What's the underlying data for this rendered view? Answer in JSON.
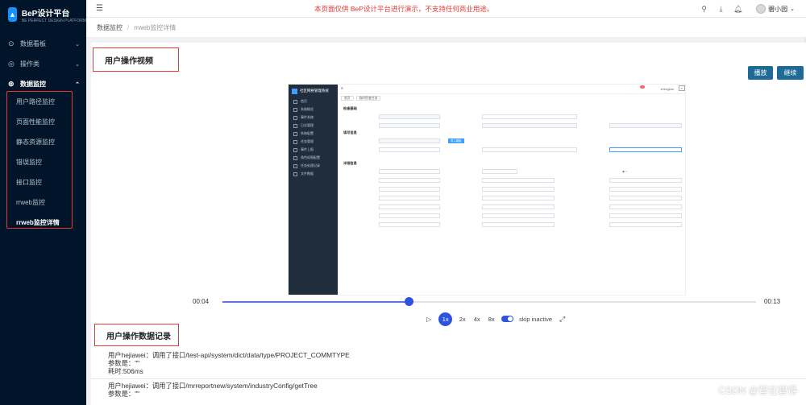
{
  "app": {
    "title": "BeP设计平台",
    "subtitle": "BE PERFECT DESIGN PLATFORM",
    "notice": "本页面仅供 BeP设计平台进行演示，不支持任何商业用途。",
    "user_name": "碧小园"
  },
  "sidebar": {
    "groups": [
      {
        "label": "数据看板",
        "icon": "dashboard-icon",
        "expanded": false
      },
      {
        "label": "操作类",
        "icon": "operation-icon",
        "expanded": false
      },
      {
        "label": "数据监控",
        "icon": "monitor-icon",
        "expanded": true
      }
    ],
    "items": [
      {
        "label": "用户路径监控"
      },
      {
        "label": "页面性能监控"
      },
      {
        "label": "静态资源监控"
      },
      {
        "label": "错误监控"
      },
      {
        "label": "接口监控"
      },
      {
        "label": "rrweb监控"
      },
      {
        "label": "rrweb监控详情",
        "active": true
      }
    ]
  },
  "breadcrumb": {
    "parent": "数据监控",
    "current": "rrweb监控详情"
  },
  "main": {
    "video_title": "用户操作视频",
    "play_label": "播放",
    "resume_label": "继续",
    "record_title": "用户操作数据记录"
  },
  "player": {
    "current_time": "00:04",
    "total_time": "00:13",
    "progress": 0.35,
    "speeds": [
      "1x",
      "2x",
      "4x",
      "8x"
    ],
    "active_speed": "1x",
    "skip_label": "skip inactive",
    "skip_enabled": true
  },
  "video_frame": {
    "app_name": "社区网格管理系统",
    "tabs": [
      "首页",
      "临时检查任务"
    ],
    "user": "zhengtao",
    "menu": [
      "首页",
      "系统概览",
      "事件系统",
      "日志管理",
      "系统配置",
      "任务管理",
      "事件上报",
      "角色权限配置",
      "任务处理记录",
      "文件数据"
    ],
    "sections": [
      "检查基础",
      "填写信息",
      "详细信息"
    ],
    "field_button": "导入模板"
  },
  "records": [
    {
      "action": "用户hejiawei：调用了接口/test-api/system/dict/data/type/PROJECT_COMMTYPE",
      "params": "参数是：\"\"",
      "duration": "耗时:506ms"
    },
    {
      "action": "用户hejiawei：调用了接口/mrreportnew/system/industryConfig/getTree",
      "params": "参数是：\"\""
    }
  ],
  "watermark": "CSDN @智在碧得",
  "colors": {
    "sidebar_bg": "#001529",
    "accent": "#1d6b96",
    "player_blue": "#2d54e0",
    "highlight_red": "#e53935"
  }
}
